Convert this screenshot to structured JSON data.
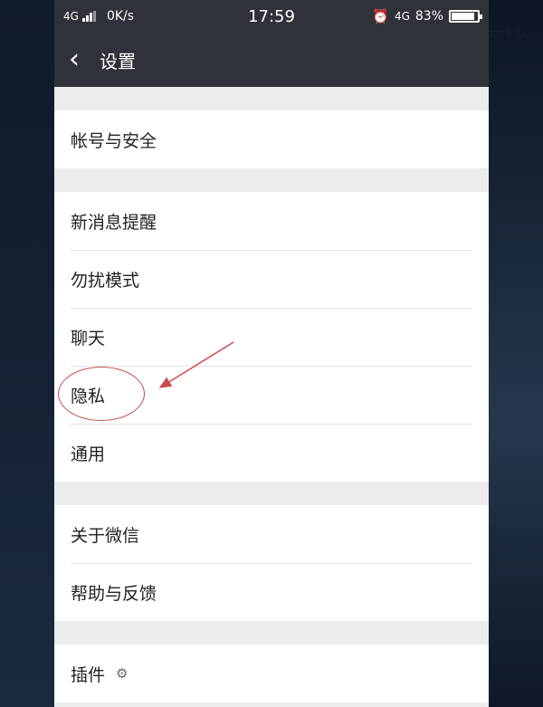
{
  "status_bar": {
    "network": "4G",
    "speed": "0K/s",
    "time": "17:59",
    "network2": "4G",
    "battery": "83%",
    "battery_level": 0.83
  },
  "header": {
    "title": "设置"
  },
  "settings": {
    "account_security": "帐号与安全",
    "new_message_alerts": "新消息提醒",
    "do_not_disturb": "勿扰模式",
    "chat": "聊天",
    "privacy": "隐私",
    "general": "通用",
    "about_wechat": "关于微信",
    "help_feedback": "帮助与反馈",
    "plugins": "插件"
  },
  "edge_text": "文件夹 T2"
}
